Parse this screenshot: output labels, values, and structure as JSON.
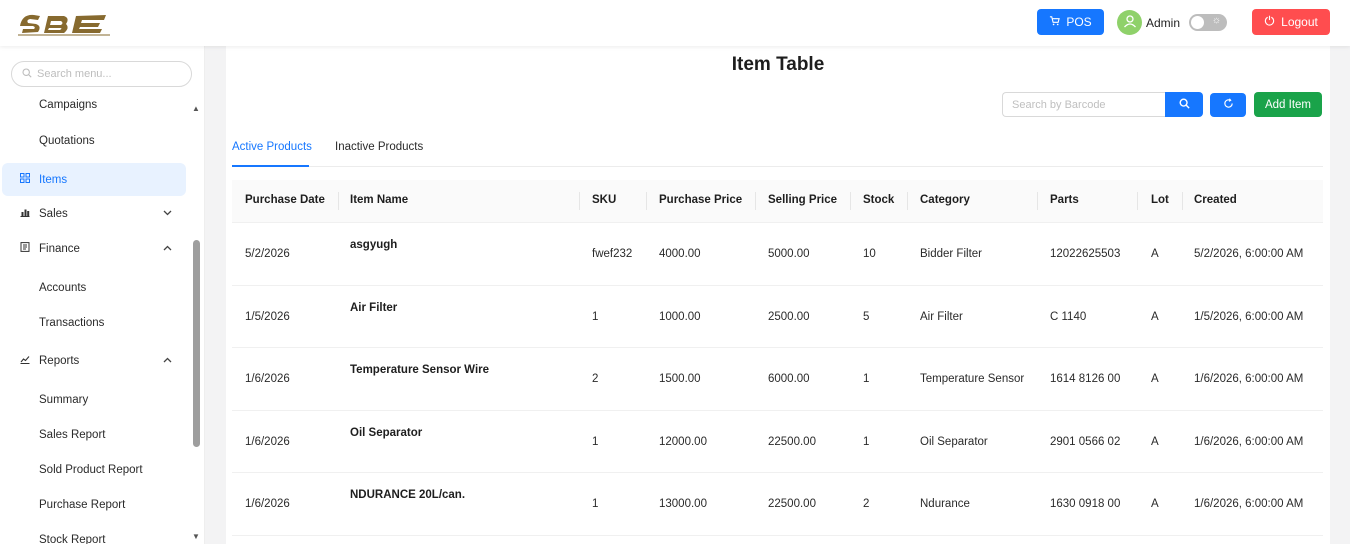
{
  "header": {
    "logo_icon": "brand-logo",
    "pos_label": "POS",
    "admin_label": "Admin",
    "logout_label": "Logout",
    "colors": {
      "primary": "#1677ff",
      "danger": "#ff4d4f",
      "success": "#1aa34a",
      "avatar": "#8fd16a"
    }
  },
  "sidebar": {
    "search_placeholder": "Search menu...",
    "items": [
      {
        "label": "Campaigns",
        "type": "sub"
      },
      {
        "label": "Quotations",
        "type": "sub"
      },
      {
        "label": "Items",
        "type": "top",
        "icon": "grid-icon",
        "active": true
      },
      {
        "label": "Sales",
        "type": "top",
        "icon": "bar-chart-icon",
        "chevron": "down"
      },
      {
        "label": "Finance",
        "type": "top",
        "icon": "ledger-icon",
        "chevron": "up"
      },
      {
        "label": "Accounts",
        "type": "sub"
      },
      {
        "label": "Transactions",
        "type": "sub"
      },
      {
        "label": "Reports",
        "type": "top",
        "icon": "line-chart-icon",
        "chevron": "up"
      },
      {
        "label": "Summary",
        "type": "sub"
      },
      {
        "label": "Sales Report",
        "type": "sub"
      },
      {
        "label": "Sold Product Report",
        "type": "sub"
      },
      {
        "label": "Purchase Report",
        "type": "sub"
      },
      {
        "label": "Stock Report",
        "type": "sub"
      }
    ]
  },
  "main": {
    "title": "Item Table",
    "barcode_placeholder": "Search by Barcode",
    "add_item_label": "Add Item",
    "tabs": [
      {
        "label": "Active Products",
        "active": true
      },
      {
        "label": "Inactive Products",
        "active": false
      }
    ],
    "table": {
      "columns": [
        "Purchase Date",
        "Item Name",
        "SKU",
        "Purchase Price",
        "Selling Price",
        "Stock",
        "Category",
        "Parts",
        "Lot",
        "Created"
      ],
      "rows": [
        [
          "5/2/2026",
          "asgyugh",
          "fwef232",
          "4000.00",
          "5000.00",
          "10",
          "Bidder Filter",
          "12022625503",
          "A",
          "5/2/2026, 6:00:00 AM"
        ],
        [
          "1/5/2026",
          "Air Filter",
          "1",
          "1000.00",
          "2500.00",
          "5",
          "Air Filter",
          "C 1140",
          "A",
          "1/5/2026, 6:00:00 AM"
        ],
        [
          "1/6/2026",
          "Temperature Sensor Wire",
          "2",
          "1500.00",
          "6000.00",
          "1",
          "Temperature Sensor",
          "1614 8126 00",
          "A",
          "1/6/2026, 6:00:00 AM"
        ],
        [
          "1/6/2026",
          "Oil Separator",
          "1",
          "12000.00",
          "22500.00",
          "1",
          "Oil Separator",
          "2901 0566 02",
          "A",
          "1/6/2026, 6:00:00 AM"
        ],
        [
          "1/6/2026",
          "NDURANCE 20L/can.",
          "1",
          "13000.00",
          "22500.00",
          "2",
          "Ndurance",
          "1630 0918 00",
          "A",
          "1/6/2026, 6:00:00 AM"
        ]
      ]
    }
  }
}
